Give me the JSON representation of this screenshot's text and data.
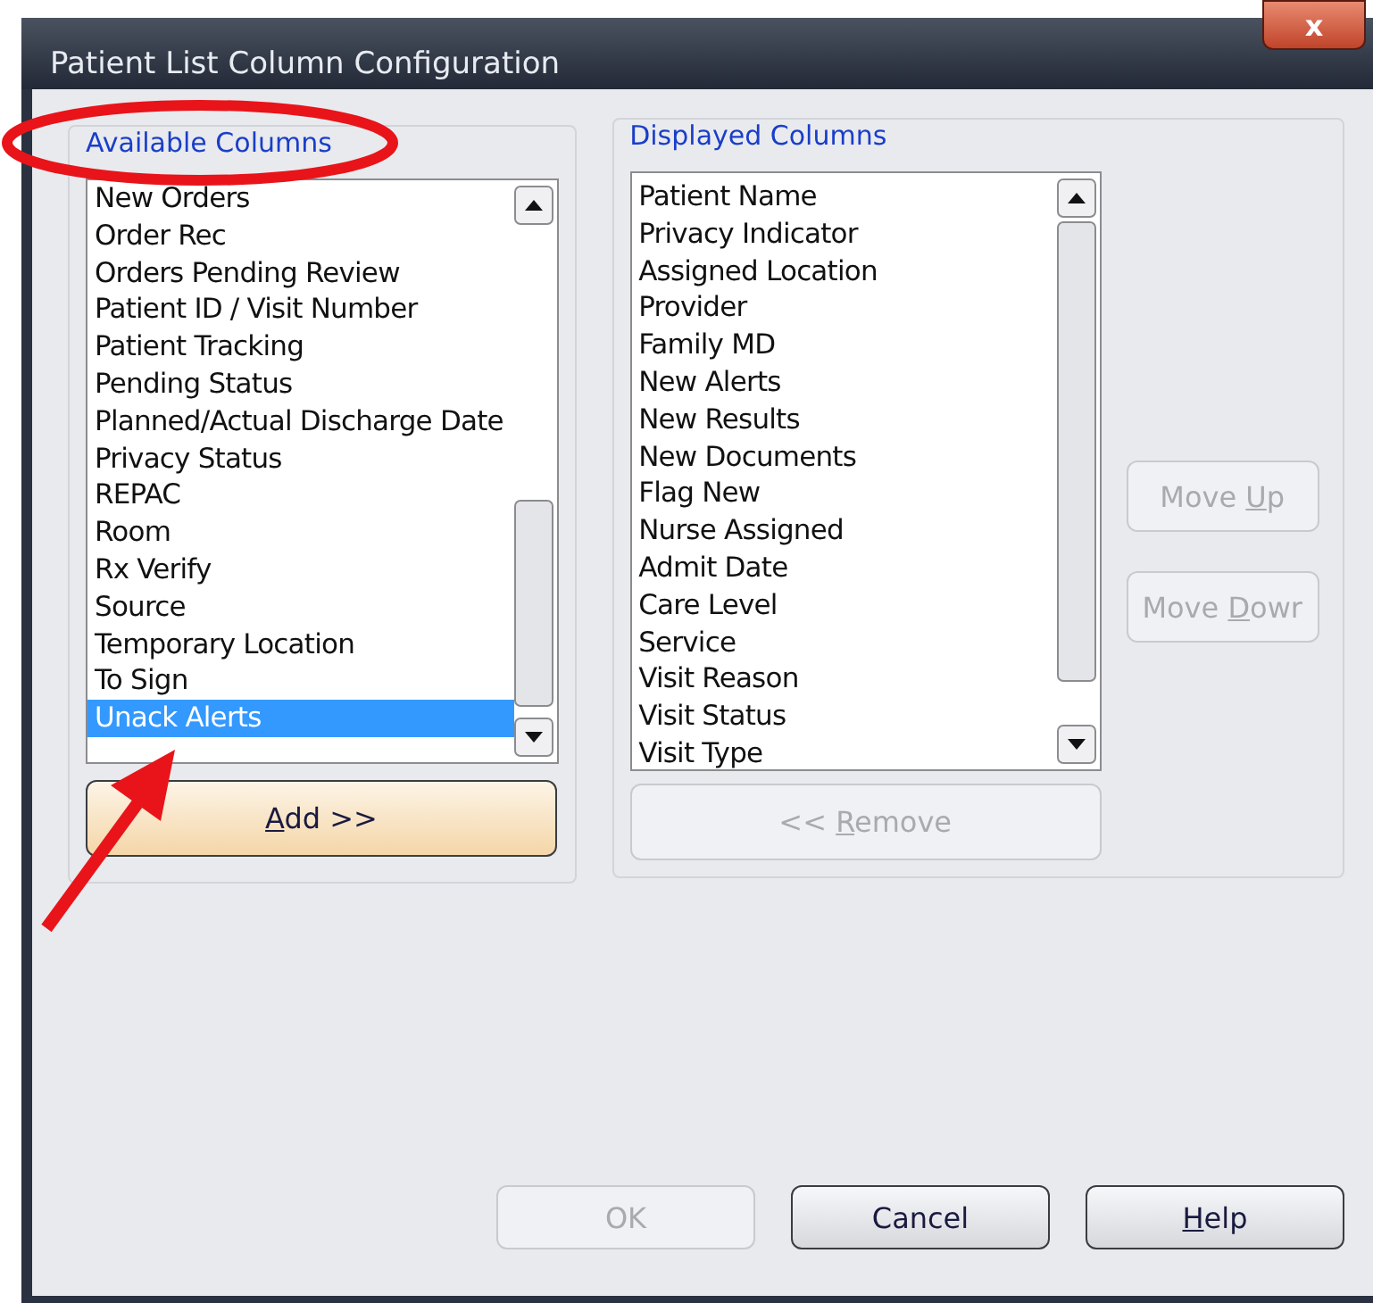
{
  "window": {
    "title": "Patient List Column Configuration",
    "close": "x"
  },
  "available": {
    "title": "Available Columns",
    "items": [
      {
        "label": "New Orders",
        "selected": false
      },
      {
        "label": "Order Rec",
        "selected": false
      },
      {
        "label": "Orders Pending Review",
        "selected": false
      },
      {
        "label": "Patient ID / Visit Number",
        "selected": false
      },
      {
        "label": "Patient Tracking",
        "selected": false
      },
      {
        "label": "Pending Status",
        "selected": false
      },
      {
        "label": "Planned/Actual Discharge Date",
        "selected": false
      },
      {
        "label": "Privacy Status",
        "selected": false
      },
      {
        "label": "REPAC",
        "selected": false
      },
      {
        "label": "Room",
        "selected": false
      },
      {
        "label": "Rx Verify",
        "selected": false
      },
      {
        "label": "Source",
        "selected": false
      },
      {
        "label": "Temporary Location",
        "selected": false
      },
      {
        "label": "To Sign",
        "selected": false
      },
      {
        "label": "Unack Alerts",
        "selected": true
      }
    ],
    "button": {
      "key": "A",
      "after": "dd >>",
      "disabled": false
    }
  },
  "displayed": {
    "title": "Displayed Columns",
    "items": [
      {
        "label": "Patient Name",
        "selected": false
      },
      {
        "label": "Privacy Indicator",
        "selected": false
      },
      {
        "label": "Assigned Location",
        "selected": false
      },
      {
        "label": "Provider",
        "selected": false
      },
      {
        "label": "Family MD",
        "selected": false
      },
      {
        "label": "New Alerts",
        "selected": false
      },
      {
        "label": "New Results",
        "selected": false
      },
      {
        "label": "New Documents",
        "selected": false
      },
      {
        "label": "Flag New",
        "selected": false
      },
      {
        "label": "Nurse Assigned",
        "selected": false
      },
      {
        "label": "Admit Date",
        "selected": false
      },
      {
        "label": "Care Level",
        "selected": false
      },
      {
        "label": "Service",
        "selected": false
      },
      {
        "label": "Visit Reason",
        "selected": false
      },
      {
        "label": "Visit Status",
        "selected": false
      },
      {
        "label": "Visit Type",
        "selected": false
      }
    ],
    "button": {
      "before": "<< ",
      "key": "R",
      "after": "emove",
      "disabled": true
    }
  },
  "move_buttons": [
    {
      "before": "Move ",
      "key": "U",
      "after": "p",
      "disabled": true
    },
    {
      "before": "Move ",
      "key": "D",
      "after": "owr",
      "disabled": true
    }
  ],
  "footer_buttons": [
    {
      "before": "OK",
      "disabled": true
    },
    {
      "before": "Cancel",
      "disabled": false
    },
    {
      "key": "H",
      "after": "elp",
      "disabled": false
    }
  ],
  "annotations": {
    "ellipse": true,
    "arrow": true
  }
}
